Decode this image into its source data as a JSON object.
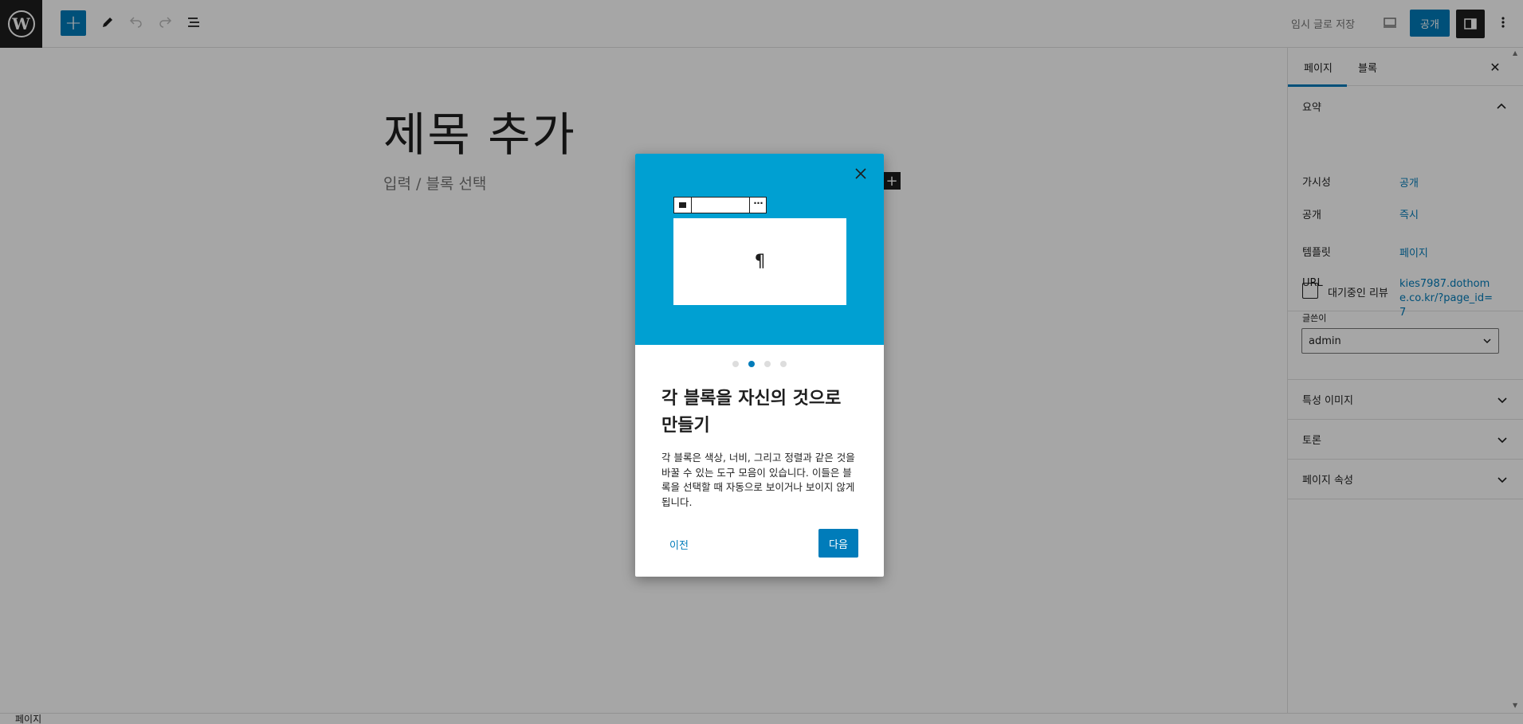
{
  "header": {
    "logo": "W",
    "add_icon": "+",
    "save_draft": "임시 글로 저장",
    "publish": "공개"
  },
  "editor": {
    "title_placeholder": "제목 추가",
    "block_placeholder": "입력 / 블록 선택",
    "inserter_icon": "+"
  },
  "sidebar": {
    "tabs": [
      {
        "label": "페이지"
      },
      {
        "label": "블록"
      }
    ],
    "close_icon": "✕",
    "summary": {
      "heading": "요약",
      "rows": [
        {
          "label": "가시성",
          "value": "공개"
        },
        {
          "label": "공개",
          "value": "즉시"
        },
        {
          "label": "템플릿",
          "value": "페이지"
        },
        {
          "label": "URL",
          "value": "kies7987.dothome.co.kr/?page_id=7"
        }
      ],
      "pending_review": "대기중인 리뷰",
      "author_label": "글쓴이",
      "author_value": "admin"
    },
    "panels": [
      {
        "label": "특성 이미지"
      },
      {
        "label": "토론"
      },
      {
        "label": "페이지 속성"
      }
    ]
  },
  "statusbar": {
    "label": "페이지"
  },
  "guide": {
    "close_icon": "✕",
    "pilcrow": "¶",
    "toolbar_more": "⋯",
    "title": "각 블록을 자신의 것으로 만들기",
    "text": "각 블록은 색상, 너비, 그리고 정렬과 같은 것을 바꿀 수 있는 도구 모음이 있습니다. 이들은 블록을 선택할 때 자동으로 보이거나 보이지 않게 됩니다.",
    "previous": "이전",
    "next": "다음",
    "step_count": 4,
    "current_step": 2
  },
  "colors": {
    "accent": "#007cba",
    "hero": "#00a0d2",
    "dark": "#1e1e1e"
  }
}
